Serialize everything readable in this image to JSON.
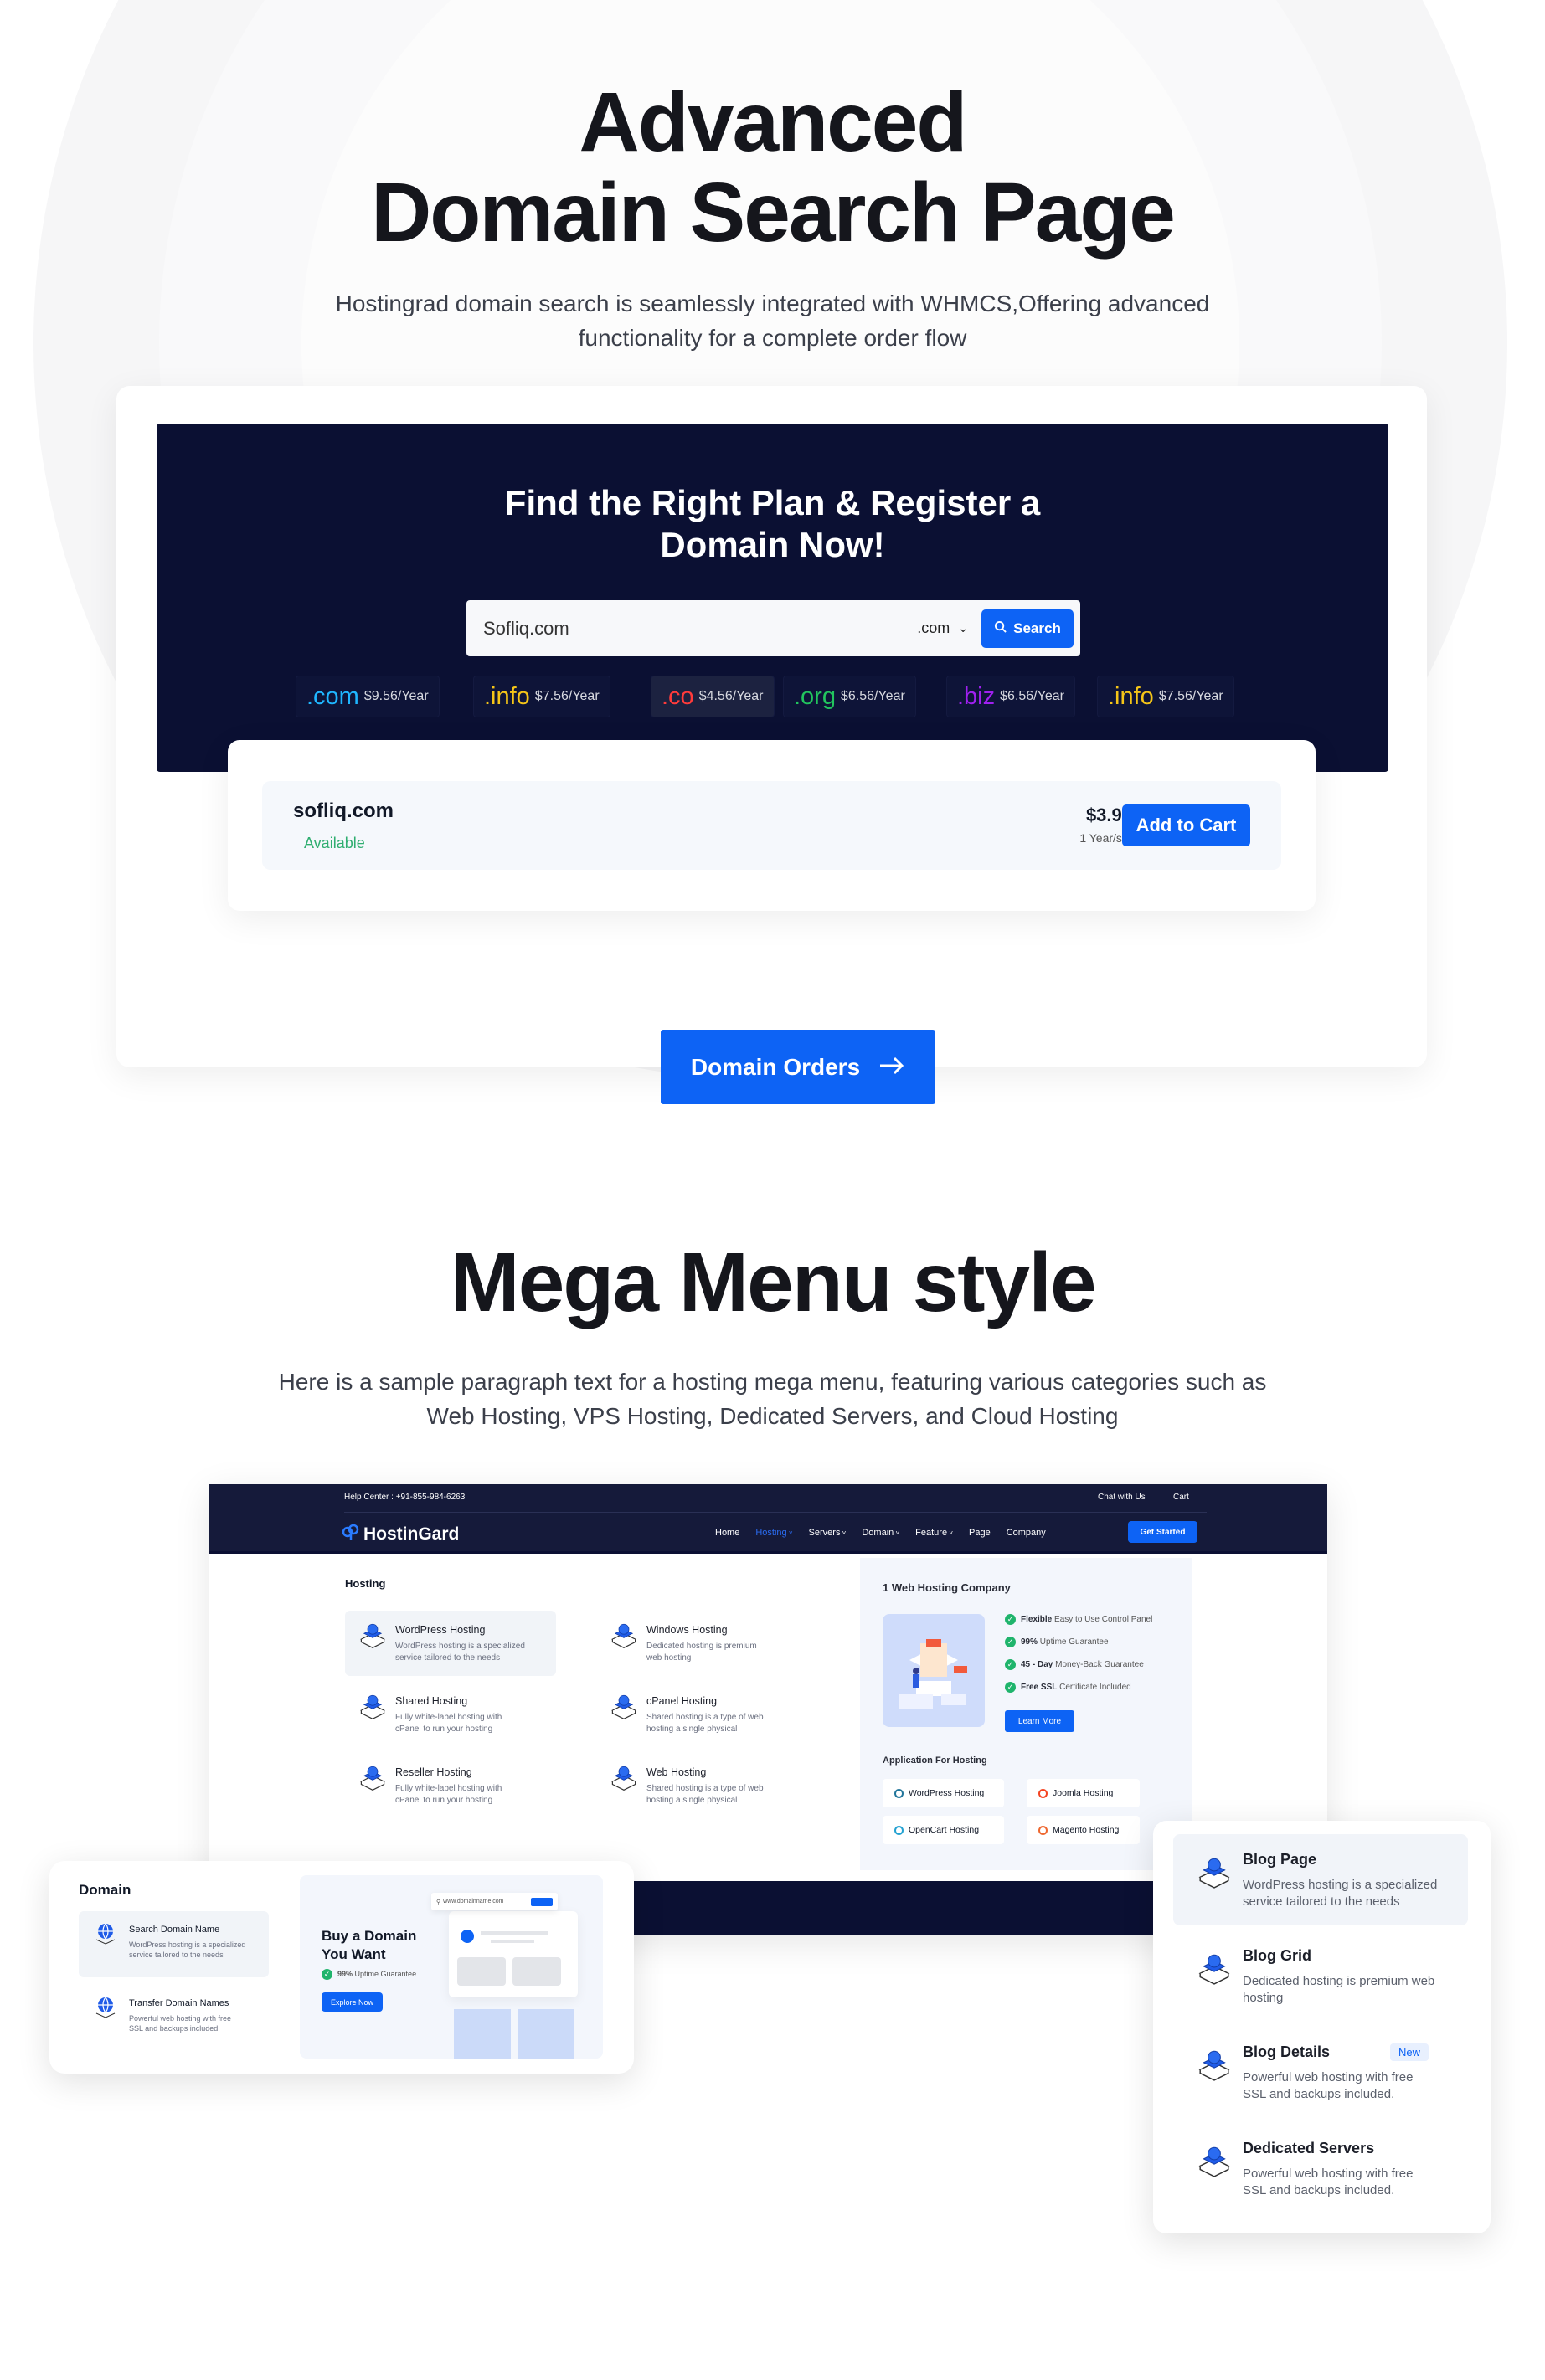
{
  "section1": {
    "title_line1": "Advanced",
    "title_line2": "Domain Search Page",
    "subtitle_line1": "Hostingrad domain search is seamlessly integrated with WHMCS,Offering advanced",
    "subtitle_line2": "functionality for a complete order flow"
  },
  "domain_search": {
    "heading_line1": "Find the Right Plan & Register a",
    "heading_line2": "Domain Now!",
    "input_value": "Sofliq.com",
    "tld_select": ".com",
    "search_label": "Search",
    "tlds": [
      {
        "ext": ".com",
        "price": "$9.56/Year",
        "color": "#1fb6ff"
      },
      {
        "ext": ".info",
        "price": "$7.56/Year",
        "color": "#f5c518"
      },
      {
        "ext": ".co",
        "price": "$4.56/Year",
        "color": "#ff3b3b"
      },
      {
        "ext": ".org",
        "price": "$6.56/Year",
        "color": "#22c55e"
      },
      {
        "ext": ".biz",
        "price": "$6.56/Year",
        "color": "#a020f0"
      },
      {
        "ext": ".info",
        "price": "$7.56/Year",
        "color": "#f5c518"
      }
    ],
    "result": {
      "domain": "sofliq.com",
      "status": "Available",
      "price": "$3.95",
      "period": "1 Year/s",
      "add_to_cart": "Add to Cart"
    },
    "cta": "Domain Orders"
  },
  "section2": {
    "title": "Mega Menu style",
    "paragraph_line1": "Here is a sample paragraph text for a hosting mega menu, featuring various categories such as",
    "paragraph_line2": "Web Hosting, VPS Hosting, Dedicated Servers, and Cloud Hosting"
  },
  "mega": {
    "topbar": {
      "help": "Help Center : +91-855-984-6263",
      "chat": "Chat with Us",
      "cart": "Cart"
    },
    "logo": "HostinGard",
    "nav": [
      {
        "label": "Home",
        "dropdown": false,
        "active": false
      },
      {
        "label": "Hosting",
        "dropdown": true,
        "active": true
      },
      {
        "label": "Servers",
        "dropdown": true,
        "active": false
      },
      {
        "label": "Domain",
        "dropdown": true,
        "active": false
      },
      {
        "label": "Feature",
        "dropdown": true,
        "active": false
      },
      {
        "label": "Page",
        "dropdown": false,
        "active": false
      },
      {
        "label": "Company",
        "dropdown": false,
        "active": false
      }
    ],
    "get_started": "Get Started",
    "hosting_title": "Hosting",
    "hosting_items": [
      {
        "title": "WordPress Hosting",
        "desc1": "WordPress hosting is a specialized",
        "desc2": "service tailored to the needs",
        "icon": "wordpress-server-icon"
      },
      {
        "title": "Windows Hosting",
        "desc1": "Dedicated hosting is premium",
        "desc2": "web hosting",
        "icon": "windows-server-icon"
      },
      {
        "title": "Shared Hosting",
        "desc1": "Fully  white-label hosting with",
        "desc2": "cPanel to run your hosting",
        "icon": "shared-server-icon"
      },
      {
        "title": "cPanel Hosting",
        "desc1": "Shared hosting is a type of web",
        "desc2": "hosting a single physical",
        "icon": "cpanel-server-icon"
      },
      {
        "title": "Reseller Hosting",
        "desc1": "Fully  white-label hosting with",
        "desc2": "cPanel to run your hosting",
        "icon": "reseller-server-icon"
      },
      {
        "title": "Web Hosting",
        "desc1": "Shared hosting is a type of web",
        "desc2": "hosting a single physical",
        "icon": "web-server-icon"
      }
    ],
    "promo": {
      "title": "1 Web Hosting Company",
      "features": [
        {
          "bold": "Flexible",
          "text": "Easy to Use Control Panel"
        },
        {
          "bold": "99%",
          "text": "Uptime Guarantee"
        },
        {
          "bold": "45 - Day",
          "text": "Money-Back Guarantee"
        },
        {
          "bold": "Free SSL",
          "text": "Certificate Included"
        }
      ],
      "learn_more": "Learn More",
      "apps_title": "Application For Hosting",
      "apps": [
        {
          "label": "WordPress Hosting",
          "icon": "wordpress-icon",
          "color": "#21759b"
        },
        {
          "label": "Joomla Hosting",
          "icon": "joomla-icon",
          "color": "#f44321"
        },
        {
          "label": "OpenCart Hosting",
          "icon": "opencart-icon",
          "color": "#23a1d1"
        },
        {
          "label": "Magento Hosting",
          "icon": "magento-icon",
          "color": "#ee672f"
        }
      ]
    }
  },
  "domain_menu": {
    "title": "Domain",
    "items": [
      {
        "title": "Search Domain Name",
        "desc1": "WordPress hosting is a specialized",
        "desc2": "service tailored to the needs"
      },
      {
        "title": "Transfer Domain Names",
        "desc1": "Powerful web hosting with free",
        "desc2": "SSL and backups included."
      }
    ],
    "promo_line1": "Buy a Domain",
    "promo_line2": "You Want",
    "uptime_bold": "99%",
    "uptime_text": "Uptime Guarantee",
    "explore": "Explore Now",
    "mock_url": "www.domainname.com"
  },
  "blog_menu": {
    "items": [
      {
        "title": "Blog Page",
        "desc1": "WordPress hosting is a specialized",
        "desc2": "service tailored to the needs",
        "badge": ""
      },
      {
        "title": "Blog Grid",
        "desc1": "Dedicated hosting is premium web",
        "desc2": "hosting",
        "badge": ""
      },
      {
        "title": "Blog Details",
        "desc1": "Powerful web hosting with free",
        "desc2": "SSL and backups included.",
        "badge": "New"
      },
      {
        "title": "Dedicated Servers",
        "desc1": "Powerful web hosting with free",
        "desc2": "SSL and backups included.",
        "badge": ""
      }
    ]
  },
  "colors": {
    "primary": "#0d63f5",
    "dark": "#0b1033",
    "success": "#1fb46c"
  }
}
